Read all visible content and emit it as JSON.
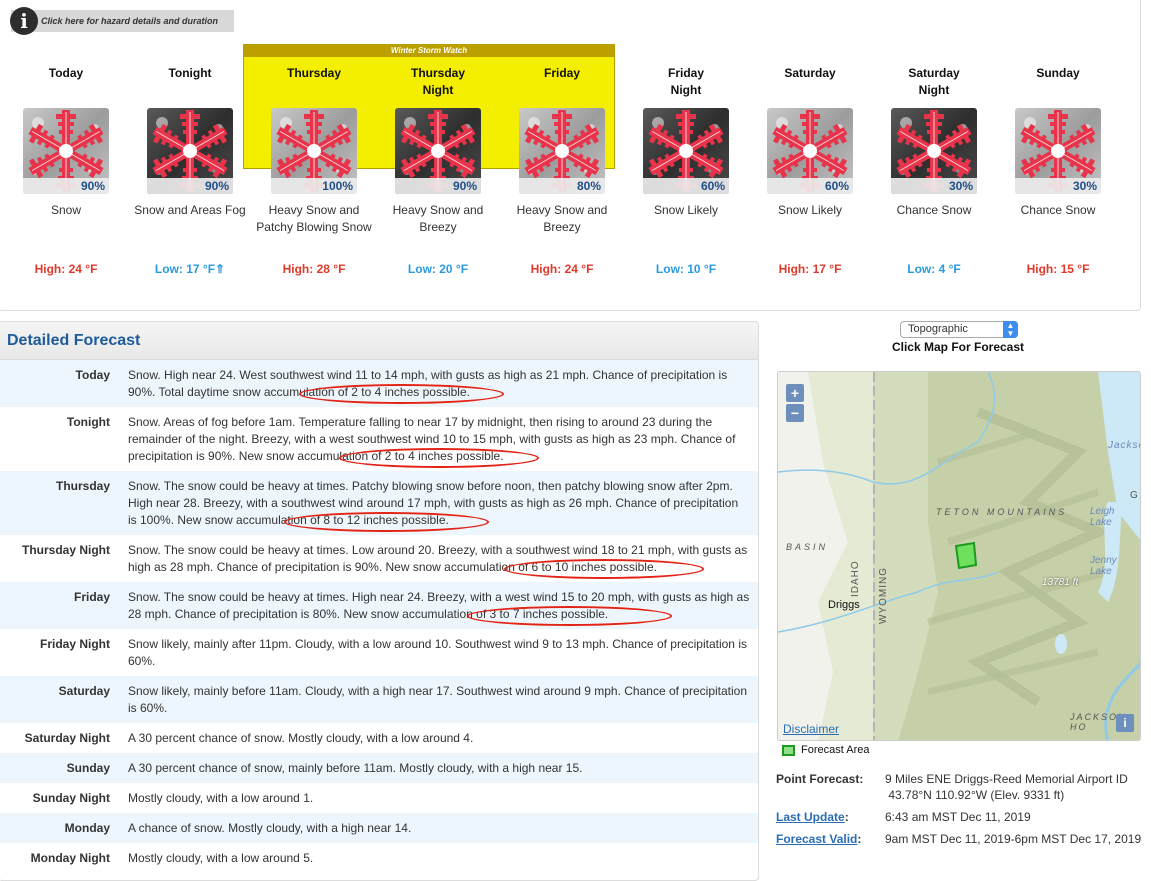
{
  "hazard": {
    "info_icon": "info-icon",
    "text": "Click here for hazard details and duration"
  },
  "watch": {
    "label": "Winter Storm Watch",
    "color": "#f4ee00"
  },
  "periods": [
    {
      "name": "Today",
      "name2": "",
      "icon": "snow-day",
      "pop": "90%",
      "desc": "Snow",
      "temp": "High: 24 °F",
      "temp_type": "high"
    },
    {
      "name": "Tonight",
      "name2": "",
      "icon": "snow-night",
      "pop": "90%",
      "desc": "Snow and Areas Fog",
      "temp": "Low: 17 °F⇑",
      "temp_type": "low"
    },
    {
      "name": "Thursday",
      "name2": "",
      "icon": "snow-day",
      "pop": "100%",
      "desc": "Heavy Snow and Patchy Blowing Snow",
      "temp": "High: 28 °F",
      "temp_type": "high"
    },
    {
      "name": "Thursday",
      "name2": "Night",
      "icon": "snow-night",
      "pop": "90%",
      "desc": "Heavy Snow and Breezy",
      "temp": "Low: 20 °F",
      "temp_type": "low"
    },
    {
      "name": "Friday",
      "name2": "",
      "icon": "snow-day",
      "pop": "80%",
      "desc": "Heavy Snow and Breezy",
      "temp": "High: 24 °F",
      "temp_type": "high"
    },
    {
      "name": "Friday",
      "name2": "Night",
      "icon": "snow-night",
      "pop": "60%",
      "desc": "Snow Likely",
      "temp": "Low: 10 °F",
      "temp_type": "low"
    },
    {
      "name": "Saturday",
      "name2": "",
      "icon": "snow-day",
      "pop": "60%",
      "desc": "Snow Likely",
      "temp": "High: 17 °F",
      "temp_type": "high"
    },
    {
      "name": "Saturday",
      "name2": "Night",
      "icon": "snow-night",
      "pop": "30%",
      "desc": "Chance Snow",
      "temp": "Low: 4 °F",
      "temp_type": "low"
    },
    {
      "name": "Sunday",
      "name2": "",
      "icon": "snow-day",
      "pop": "30%",
      "desc": "Chance Snow",
      "temp": "High: 15 °F",
      "temp_type": "high"
    }
  ],
  "detailed": {
    "title": "Detailed Forecast",
    "rows": [
      {
        "label": "Today",
        "text": "Snow. High near 24. West southwest wind 11 to 14 mph, with gusts as high as 21 mph. Chance of precipitation is 90%. Total daytime snow accumulation of 2 to 4 inches possible."
      },
      {
        "label": "Tonight",
        "text": "Snow. Areas of fog before 1am. Temperature falling to near 17 by midnight, then rising to around 23 during the remainder of the night. Breezy, with a west southwest wind 10 to 15 mph, with gusts as high as 23 mph. Chance of precipitation is 90%. New snow accumulation of 2 to 4 inches possible."
      },
      {
        "label": "Thursday",
        "text": "Snow. The snow could be heavy at times. Patchy blowing snow before noon, then patchy blowing snow after 2pm. High near 28. Breezy, with a southwest wind around 17 mph, with gusts as high as 26 mph. Chance of precipitation is 100%. New snow accumulation of 8 to 12 inches possible."
      },
      {
        "label": "Thursday Night",
        "text": "Snow. The snow could be heavy at times. Low around 20. Breezy, with a southwest wind 18 to 21 mph, with gusts as high as 28 mph. Chance of precipitation is 90%. New snow accumulation of 6 to 10 inches possible."
      },
      {
        "label": "Friday",
        "text": "Snow. The snow could be heavy at times. High near 24. Breezy, with a west wind 15 to 20 mph, with gusts as high as 28 mph. Chance of precipitation is 80%. New snow accumulation of 3 to 7 inches possible."
      },
      {
        "label": "Friday Night",
        "text": "Snow likely, mainly after 11pm. Cloudy, with a low around 10. Southwest wind 9 to 13 mph. Chance of precipitation is 60%."
      },
      {
        "label": "Saturday",
        "text": "Snow likely, mainly before 11am. Cloudy, with a high near 17. Southwest wind around 9 mph. Chance of precipitation is 60%."
      },
      {
        "label": "Saturday Night",
        "text": "A 30 percent chance of snow. Mostly cloudy, with a low around 4."
      },
      {
        "label": "Sunday",
        "text": "A 30 percent chance of snow, mainly before 11am. Mostly cloudy, with a high near 15."
      },
      {
        "label": "Sunday Night",
        "text": "Mostly cloudy, with a low around 1."
      },
      {
        "label": "Monday",
        "text": "A chance of snow. Mostly cloudy, with a high near 14."
      },
      {
        "label": "Monday Night",
        "text": "Mostly cloudy, with a low around 5."
      }
    ]
  },
  "map": {
    "layer_select": "Topographic",
    "caption": "Click Map For Forecast",
    "zoom_in": "+",
    "zoom_out": "−",
    "labels": {
      "jackson": "Jackso",
      "g": "G",
      "teton": "TETON MOUNTAINS",
      "leigh": "Leigh Lake",
      "jenny": "Jenny Lake",
      "basin": "BASIN",
      "idaho": "IDAHO",
      "wyoming": "WYOMING",
      "peak": "13781 ft",
      "driggs": "Driggs",
      "jackson_hole": "JACKSON HO"
    },
    "disclaimer": "Disclaimer",
    "info_btn": "i",
    "legend": "Forecast Area"
  },
  "point_info": {
    "point_label": "Point Forecast:",
    "point_value": "9 Miles ENE Driggs-Reed Memorial Airport ID",
    "point_coords": " 43.78°N 110.92°W (Elev. 9331 ft)",
    "update_label": "Last Update",
    "update_value": "6:43 am MST Dec 11, 2019",
    "valid_label": "Forecast Valid",
    "valid_value": "9am MST Dec 11, 2019-6pm MST Dec 17, 2019"
  }
}
